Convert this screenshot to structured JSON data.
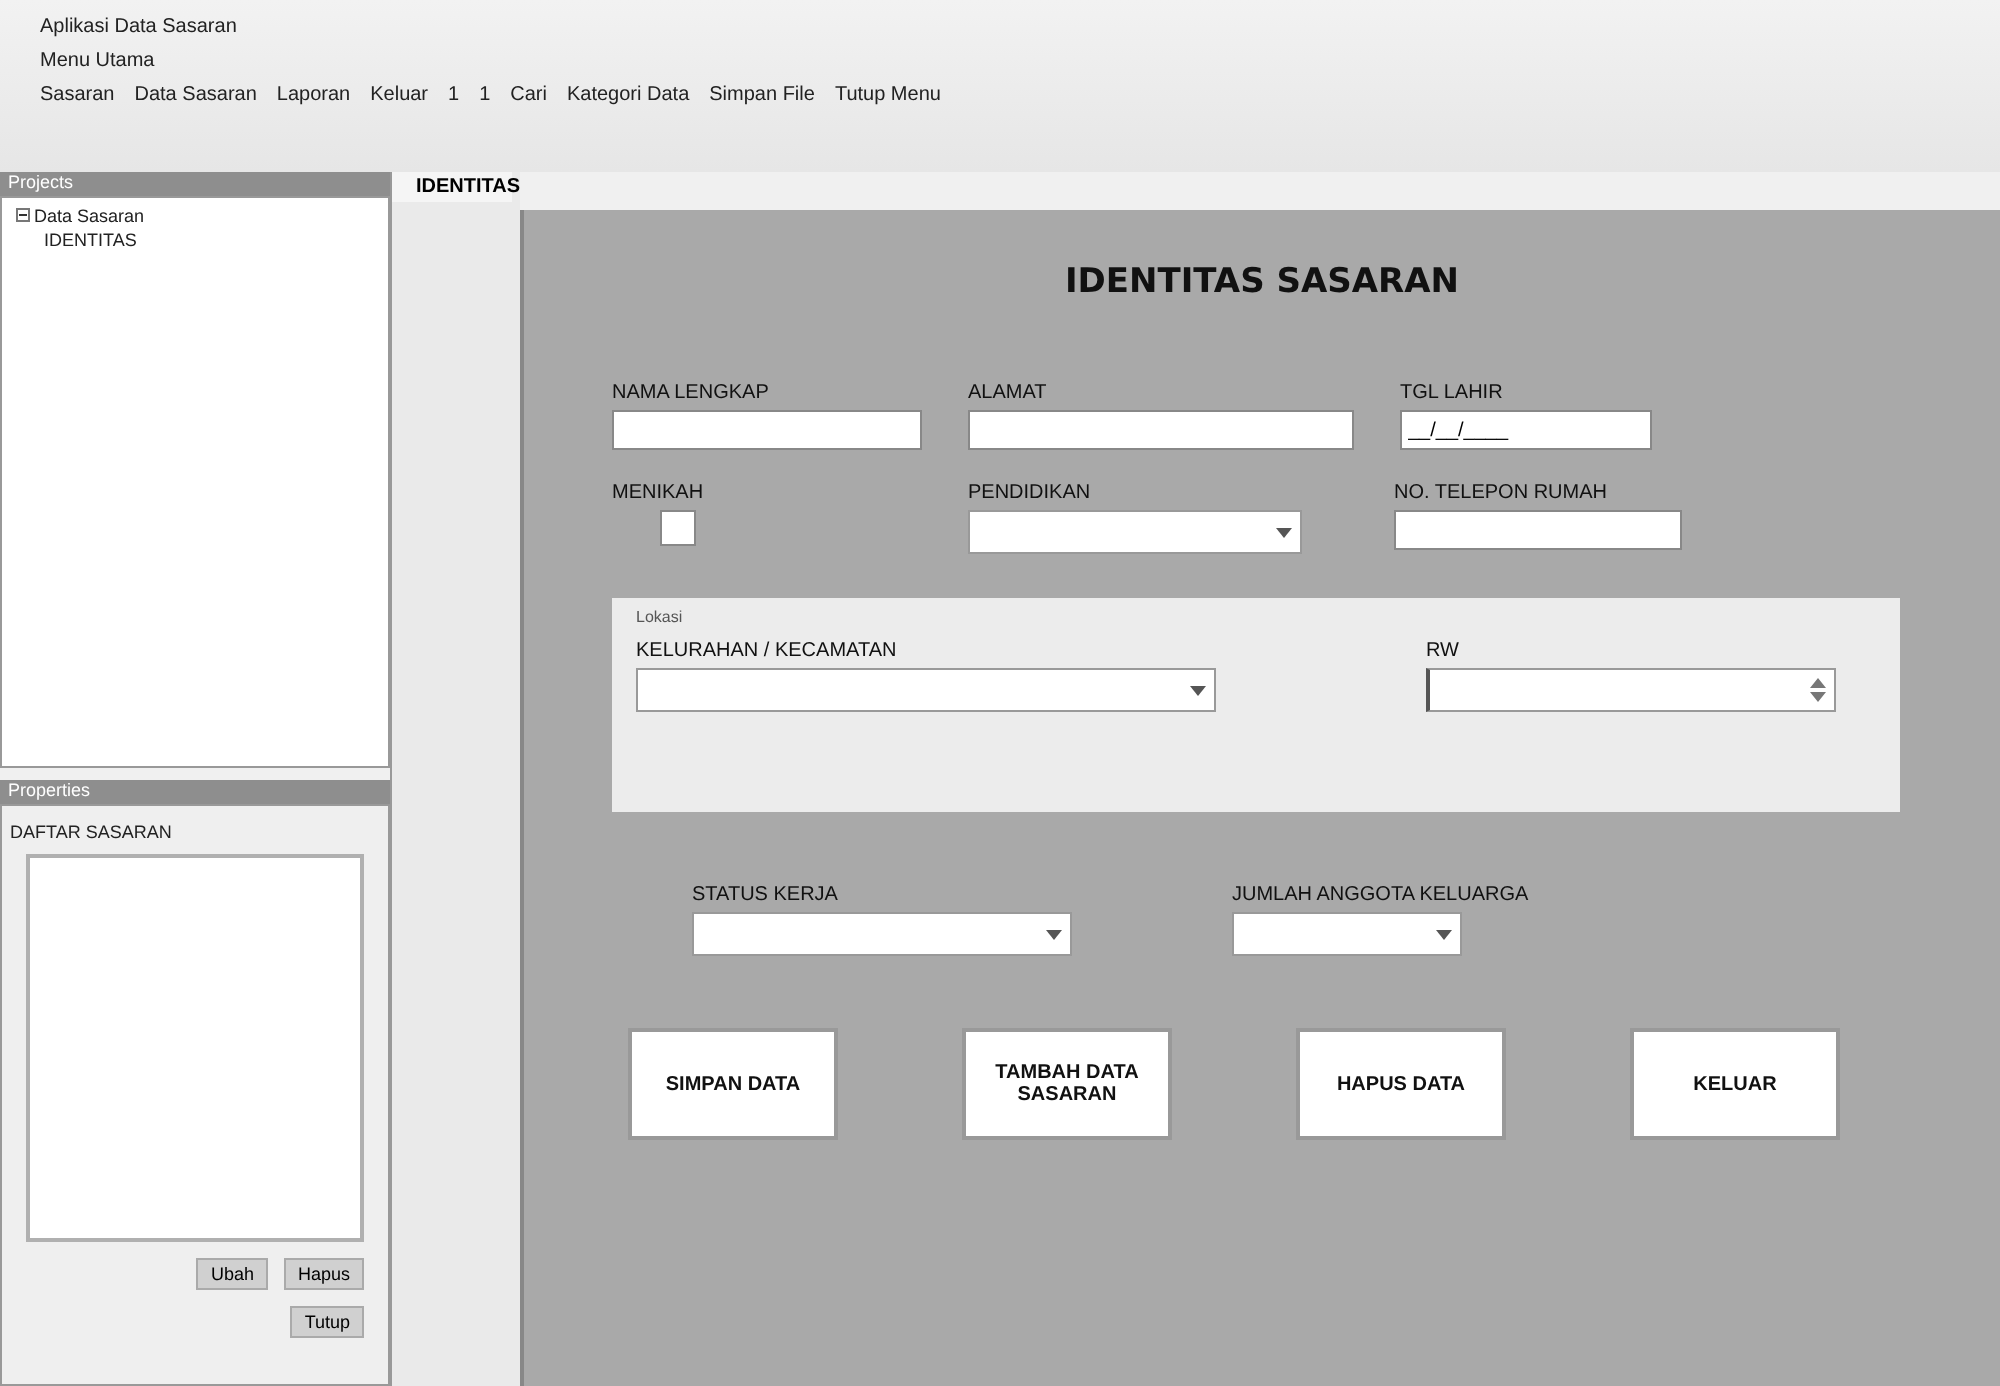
{
  "menu_lines": [
    "Aplikasi Data Sasaran",
    "Menu Utama"
  ],
  "toolbar": [
    "Sasaran",
    "Data Sasaran",
    "Laporan",
    "Keluar",
    "1",
    "1",
    "Cari",
    "Kategori Data",
    "Simpan File",
    "Tutup Menu"
  ],
  "projects_panel": {
    "title": "Projects",
    "tree": [
      {
        "label": "Data Sasaran",
        "expanded": true,
        "children": [
          {
            "label": "IDENTITAS"
          }
        ]
      }
    ]
  },
  "lower_panel": {
    "title": "Properties",
    "label": "DAFTAR SASARAN",
    "buttons": [
      "Ubah",
      "Hapus"
    ],
    "footer_button": "Tutup"
  },
  "tab": {
    "label": "IDENTITAS",
    "selected": true
  },
  "form": {
    "title": "IDENTITAS SASARAN",
    "fields": [
      {
        "kind": "text",
        "label": "NAMA LENGKAP"
      },
      {
        "kind": "text",
        "label": "ALAMAT"
      },
      {
        "kind": "date",
        "label": "TGL LAHIR",
        "value": "__/__/____"
      },
      {
        "kind": "checkbox",
        "label": "MENIKAH",
        "checked": false
      },
      {
        "kind": "combo",
        "label": "PENDIDIKAN"
      },
      {
        "kind": "text",
        "label": "NO. TELEPON RUMAH"
      }
    ],
    "group": {
      "title": "Lokasi",
      "fields": [
        {
          "kind": "combo",
          "label": "KELURAHAN / KECAMATAN"
        },
        {
          "kind": "spinner",
          "label": "RW"
        }
      ]
    },
    "lower_fields": [
      {
        "kind": "combo",
        "label": "STATUS KERJA"
      },
      {
        "kind": "combo",
        "label": "JUMLAH ANGGOTA KELUARGA"
      }
    ],
    "buttons": [
      "SIMPAN DATA",
      "TAMBAH DATA SASARAN",
      "HAPUS DATA",
      "KELUAR"
    ]
  }
}
